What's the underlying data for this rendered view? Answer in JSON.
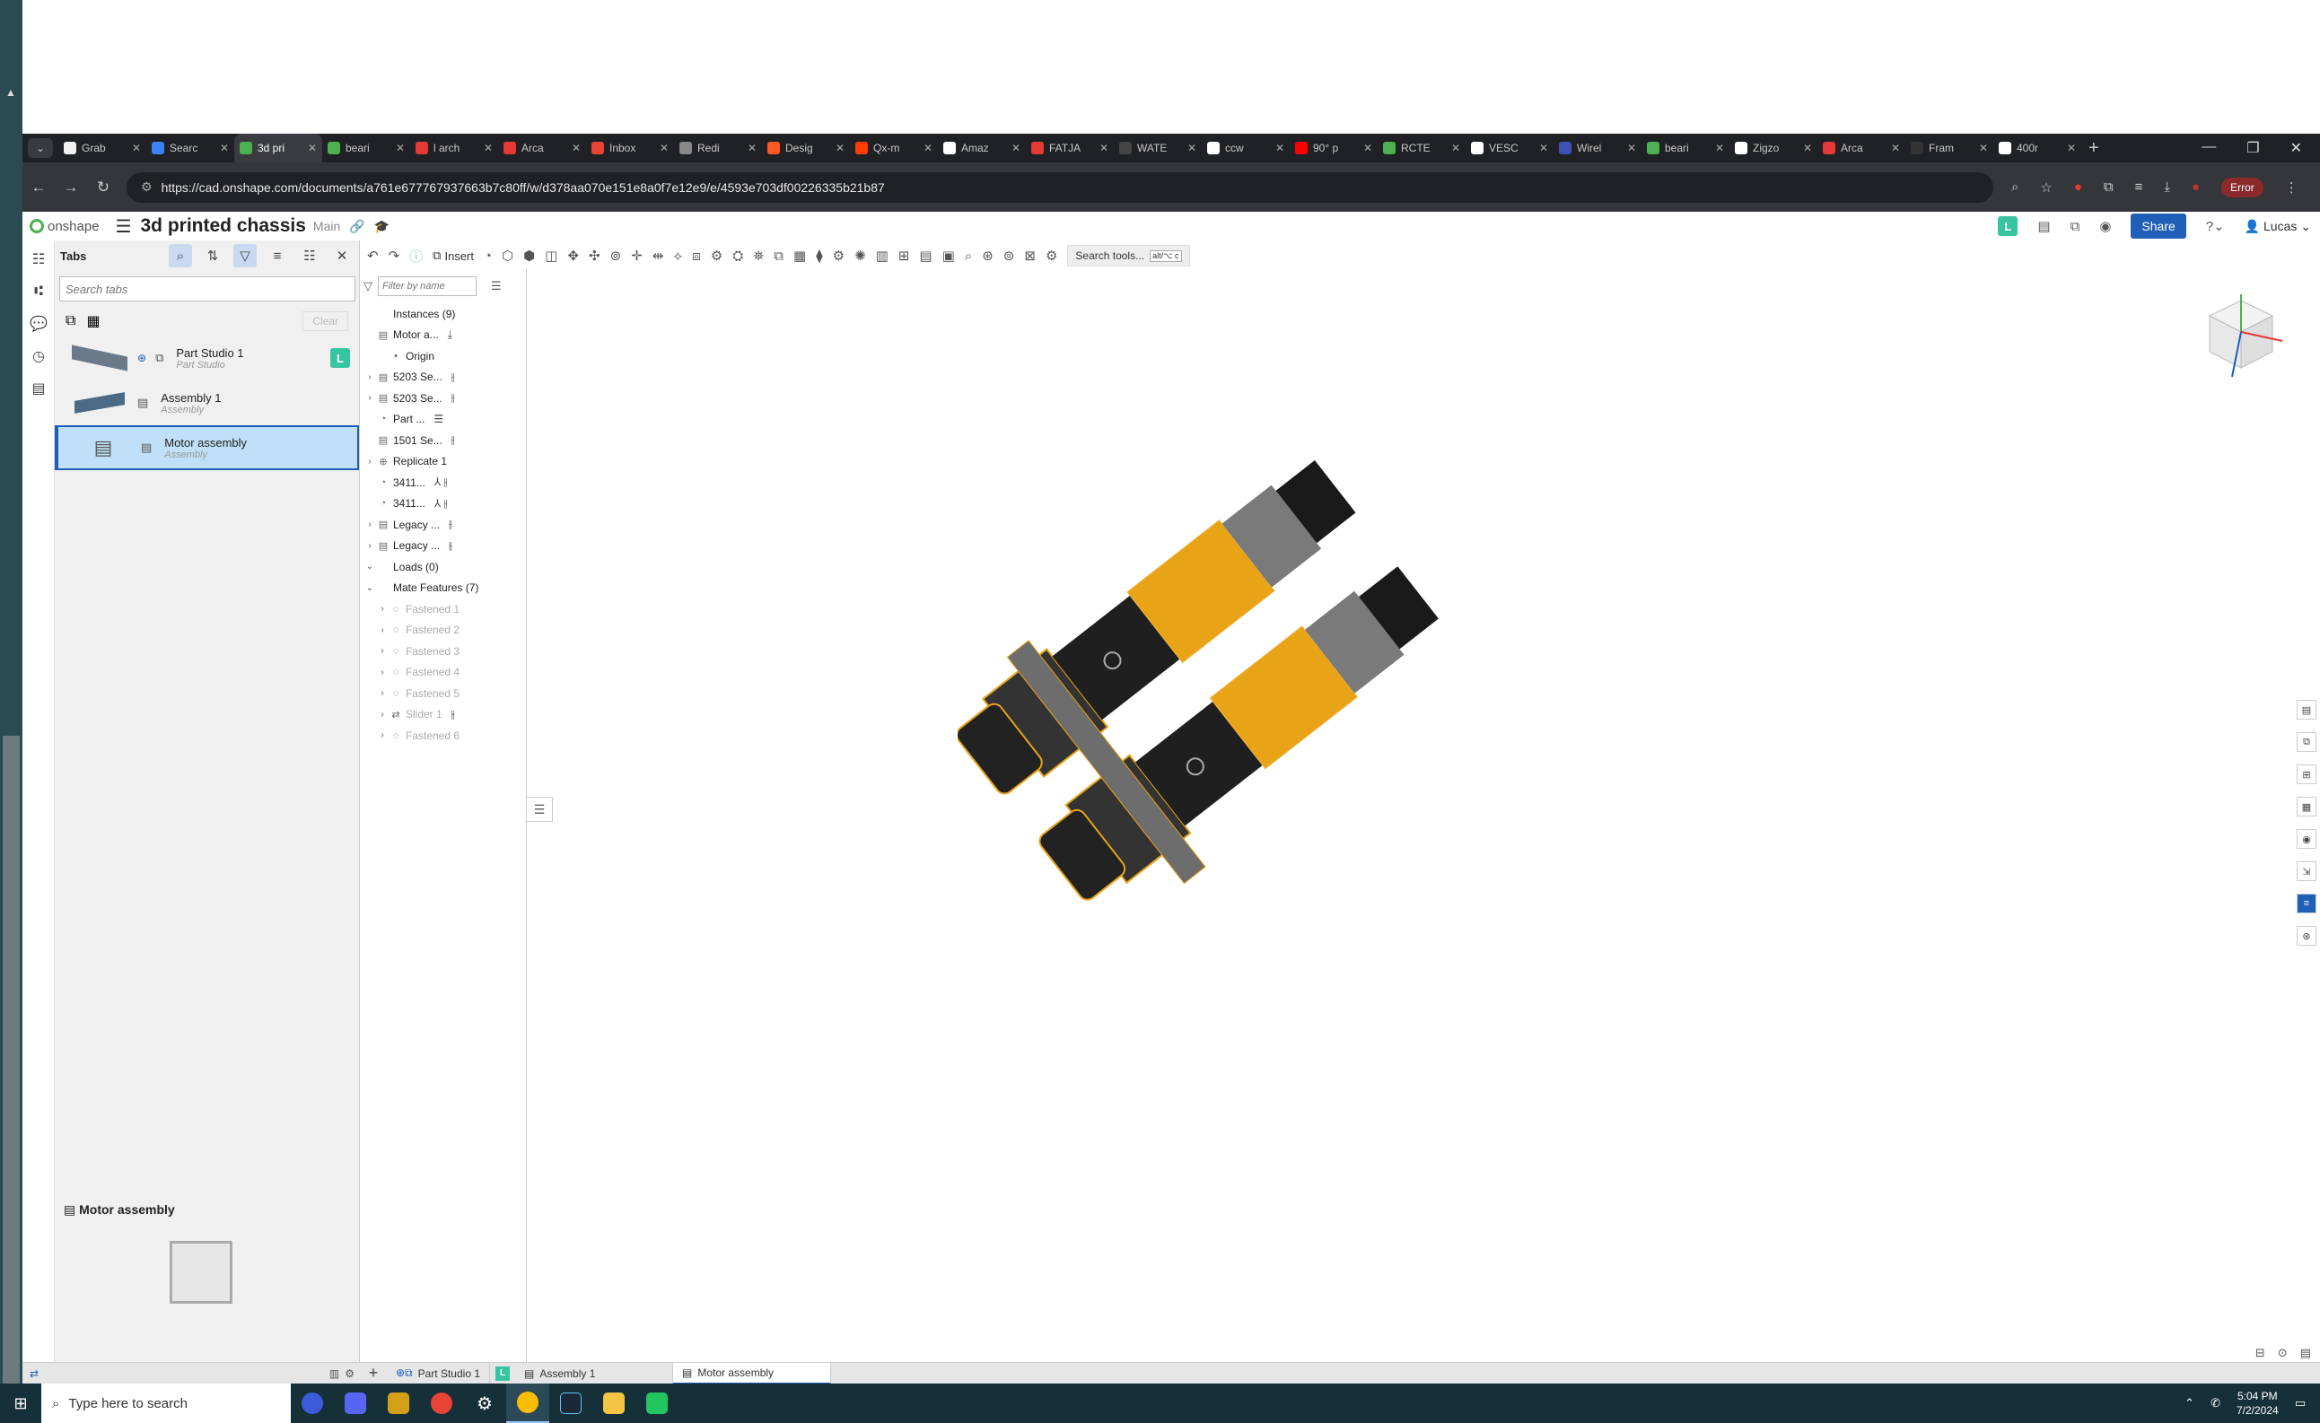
{
  "browser": {
    "tabs": [
      {
        "label": "Grab",
        "color": "#f0f0f0"
      },
      {
        "label": "Searc",
        "color": "#3b82f6"
      },
      {
        "label": "3d pri",
        "color": "#4caf50",
        "active": true
      },
      {
        "label": "beari",
        "color": "#4caf50"
      },
      {
        "label": "l arch",
        "color": "#e53935"
      },
      {
        "label": "Arca",
        "color": "#e53935"
      },
      {
        "label": "Inbox",
        "color": "#ea4335"
      },
      {
        "label": "Redi",
        "color": "#888888"
      },
      {
        "label": "Desig",
        "color": "#ff5722"
      },
      {
        "label": "Qx-m",
        "color": "#ff3d00"
      },
      {
        "label": "Amaz",
        "color": "#ffffff"
      },
      {
        "label": "FATJA",
        "color": "#e53935"
      },
      {
        "label": "WATE",
        "color": "#444444"
      },
      {
        "label": "ccw",
        "color": "#ffffff"
      },
      {
        "label": "90° p",
        "color": "#ff0000"
      },
      {
        "label": "RCTE",
        "color": "#4caf50"
      },
      {
        "label": "VESC",
        "color": "#ffffff"
      },
      {
        "label": "Wirel",
        "color": "#3f51b5"
      },
      {
        "label": "beari",
        "color": "#4caf50"
      },
      {
        "label": "Zigzo",
        "color": "#ffffff"
      },
      {
        "label": "Arca",
        "color": "#e53935"
      },
      {
        "label": "Fram",
        "color": "#333333"
      },
      {
        "label": "400r",
        "color": "#ffffff"
      }
    ],
    "new_tab": "+",
    "url": "https://cad.onshape.com/documents/a761e677767937663b7c80ff/w/d378aa070e151e8a0f7e12e9/e/4593e703df00226335b21b87",
    "error_label": "Error"
  },
  "header": {
    "logo_text": "onshape",
    "doc_title": "3d printed chassis",
    "branch": "Main",
    "badge": "L",
    "share_label": "Share",
    "user": "Lucas"
  },
  "tabs_panel": {
    "title": "Tabs",
    "search_placeholder": "Search tabs",
    "clear_label": "Clear",
    "items": [
      {
        "name": "Part Studio 1",
        "type": "Part Studio"
      },
      {
        "name": "Assembly 1",
        "type": "Assembly"
      },
      {
        "name": "Motor assembly",
        "type": "Assembly"
      }
    ],
    "footer_name": "Motor assembly"
  },
  "toolbar": {
    "insert_label": "Insert",
    "search_tools_label": "Search tools...",
    "search_tools_shortcut": "alt/⌥ c"
  },
  "tree": {
    "filter_placeholder": "Filter by name",
    "rows": [
      {
        "text": "Instances (9)",
        "indent": 0,
        "caret": "",
        "icon": "",
        "suffix": "",
        "muted": false
      },
      {
        "text": "Motor a...",
        "indent": 0,
        "caret": "",
        "icon": "▤",
        "suffix": "⤓",
        "muted": false
      },
      {
        "text": "Origin",
        "indent": 1,
        "caret": "",
        "icon": "•",
        "suffix": "",
        "muted": false
      },
      {
        "text": "5203 Se...",
        "indent": 0,
        "caret": "›",
        "icon": "▤",
        "suffix": "⫲",
        "muted": false
      },
      {
        "text": "5203 Se...",
        "indent": 0,
        "caret": "›",
        "icon": "▤",
        "suffix": "⫲",
        "muted": false
      },
      {
        "text": "Part ...",
        "indent": 0,
        "caret": "",
        "icon": "◔",
        "suffix": "☰",
        "muted": false
      },
      {
        "text": "1501 Se...",
        "indent": 0,
        "caret": "",
        "icon": "▤",
        "suffix": "⫲",
        "muted": false
      },
      {
        "text": "Replicate 1",
        "indent": 0,
        "caret": "›",
        "icon": "⊕",
        "suffix": "",
        "muted": false
      },
      {
        "text": "3411...",
        "indent": 0,
        "caret": "",
        "icon": "◔",
        "suffix": "⅄ ⫲",
        "muted": false
      },
      {
        "text": "3411...",
        "indent": 0,
        "caret": "",
        "icon": "◔",
        "suffix": "⅄ ⫲",
        "muted": false
      },
      {
        "text": "Legacy ...",
        "indent": 0,
        "caret": "›",
        "icon": "▤",
        "suffix": "⫲",
        "muted": false
      },
      {
        "text": "Legacy ...",
        "indent": 0,
        "caret": "›",
        "icon": "▤",
        "suffix": "⫲",
        "muted": false
      },
      {
        "text": "Loads (0)",
        "indent": 0,
        "caret": "⌄",
        "icon": "",
        "suffix": "",
        "muted": false
      },
      {
        "text": "Mate Features (7)",
        "indent": 0,
        "caret": "⌄",
        "icon": "",
        "suffix": "",
        "muted": false
      },
      {
        "text": "Fastened 1",
        "indent": 1,
        "caret": "›",
        "icon": "◌",
        "suffix": "",
        "muted": true
      },
      {
        "text": "Fastened 2",
        "indent": 1,
        "caret": "›",
        "icon": "◌",
        "suffix": "",
        "muted": true
      },
      {
        "text": "Fastened 3",
        "indent": 1,
        "caret": "›",
        "icon": "◌",
        "suffix": "",
        "muted": true
      },
      {
        "text": "Fastened 4",
        "indent": 1,
        "caret": "›",
        "icon": "◌",
        "suffix": "",
        "muted": true
      },
      {
        "text": "Fastened 5",
        "indent": 1,
        "caret": "›",
        "icon": "◌",
        "suffix": "",
        "muted": true
      },
      {
        "text": "Slider 1",
        "indent": 1,
        "caret": "›",
        "icon": "⇄",
        "suffix": "⫲",
        "muted": true
      },
      {
        "text": "Fastened 6",
        "indent": 1,
        "caret": "›",
        "icon": "◌",
        "suffix": "",
        "muted": true
      }
    ]
  },
  "bottom_tabs": [
    {
      "label": "Part Studio 1",
      "active": false
    },
    {
      "label": "Assembly 1",
      "active": false
    },
    {
      "label": "Motor assembly",
      "active": true
    }
  ],
  "taskbar": {
    "search_placeholder": "Type here to search",
    "time": "5:04 PM",
    "date": "7/2/2024"
  },
  "colors": {
    "accent": "#1f5fb8",
    "motor_yellow": "#e8a317",
    "badge_green": "#37c4a0"
  }
}
